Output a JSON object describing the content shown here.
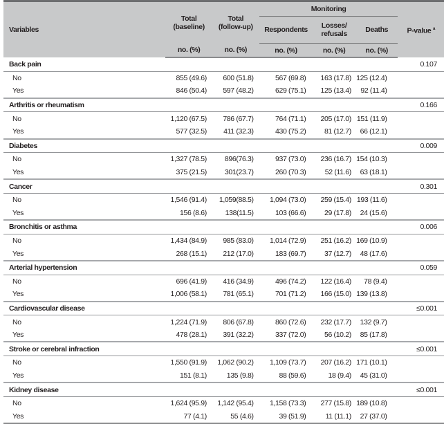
{
  "header": {
    "variables": "Variables",
    "total_baseline_line1": "Total",
    "total_baseline_line2": "(baseline)",
    "total_followup_line1": "Total",
    "total_followup_line2": "(follow-up)",
    "monitoring": "Monitoring",
    "respondents": "Respondents",
    "losses_line1": "Losses/",
    "losses_line2": "refusals",
    "deaths": "Deaths",
    "pvalue": "P-value",
    "pvalue_footnote": "a",
    "unit": "no. (%)"
  },
  "groups": [
    {
      "name": "Back pain",
      "p": "0.107",
      "rows": [
        {
          "label": "No",
          "values": [
            "855 (49.6)",
            "600 (51.8)",
            "567 (69.8)",
            "163 (17.8)",
            "125 (12.4)"
          ]
        },
        {
          "label": "Yes",
          "values": [
            "846 (50.4)",
            "597 (48.2)",
            "629 (75.1)",
            "125 (13.4)",
            "92 (11.4)"
          ]
        }
      ]
    },
    {
      "name": "Arthritis or rheumatism",
      "p": "0.166",
      "rows": [
        {
          "label": "No",
          "values": [
            "1,120 (67.5)",
            "786 (67.7)",
            "764 (71.1)",
            "205 (17.0)",
            "151 (11.9)"
          ]
        },
        {
          "label": "Yes",
          "values": [
            "577 (32.5)",
            "411 (32.3)",
            "430 (75.2)",
            "81 (12.7)",
            "66 (12.1)"
          ]
        }
      ]
    },
    {
      "name": "Diabetes",
      "p": "0.009",
      "rows": [
        {
          "label": "No",
          "values": [
            "1,327 (78.5)",
            "896(76.3)",
            "937 (73.0)",
            "236 (16.7)",
            "154 (10.3)"
          ]
        },
        {
          "label": "Yes",
          "values": [
            "375 (21.5)",
            "301(23.7)",
            "260 (70.3)",
            "52 (11.6)",
            "63 (18.1)"
          ]
        }
      ]
    },
    {
      "name": "Cancer",
      "p": "0.301",
      "rows": [
        {
          "label": "No",
          "values": [
            "1,546 (91.4)",
            "1,059(88.5)",
            "1,094 (73.0)",
            "259 (15.4)",
            "193 (11.6)"
          ]
        },
        {
          "label": "Yes",
          "values": [
            "156 (8.6)",
            "138(11.5)",
            "103 (66.6)",
            "29 (17.8)",
            "24 (15.6)"
          ]
        }
      ]
    },
    {
      "name": "Bronchitis or asthma",
      "p": "0.006",
      "rows": [
        {
          "label": "No",
          "values": [
            "1,434 (84.9)",
            "985 (83.0)",
            "1,014 (72.9)",
            "251 (16.2)",
            "169 (10.9)"
          ]
        },
        {
          "label": "Yes",
          "values": [
            "268 (15.1)",
            "212 (17.0)",
            "183 (69.7)",
            "37 (12.7)",
            "48 (17.6)"
          ]
        }
      ]
    },
    {
      "name": "Arterial hypertension",
      "p": "0.059",
      "rows": [
        {
          "label": "No",
          "values": [
            "696 (41.9)",
            "416 (34.9)",
            "496 (74.2)",
            "122 (16.4)",
            "78 (9.4)"
          ]
        },
        {
          "label": "Yes",
          "values": [
            "1,006 (58.1)",
            "781 (65.1)",
            "701 (71.2)",
            "166 (15.0)",
            "139 (13.8)"
          ]
        }
      ]
    },
    {
      "name": "Cardiovascular disease",
      "p": "≤0.001",
      "rows": [
        {
          "label": "No",
          "values": [
            "1,224 (71.9)",
            "806 (67.8)",
            "860 (72.6)",
            "232 (17.7)",
            "132 (9.7)"
          ]
        },
        {
          "label": "Yes",
          "values": [
            "478 (28.1)",
            "391 (32.2)",
            "337 (72.0)",
            "56 (10.2)",
            "85 (17.8)"
          ]
        }
      ]
    },
    {
      "name": "Stroke or cerebral infraction",
      "p": "≤0.001",
      "rows": [
        {
          "label": "No",
          "values": [
            "1,550 (91.9)",
            "1,062 (90.2)",
            "1,109 (73.7)",
            "207 (16.2)",
            "171 (10.1)"
          ]
        },
        {
          "label": "Yes",
          "values": [
            "151 (8.1)",
            "135 (9.8)",
            "88 (59.6)",
            "18 (9.4)",
            "45 (31.0)"
          ]
        }
      ]
    },
    {
      "name": "Kidney disease",
      "p": "≤0.001",
      "rows": [
        {
          "label": "No",
          "values": [
            "1,624 (95.9)",
            "1,142 (95.4)",
            "1,158 (73.3)",
            "277 (15.8)",
            "189 (10.8)"
          ]
        },
        {
          "label": "Yes",
          "values": [
            "77 (4.1)",
            "55 (4.6)",
            "39 (51.9)",
            "11 (11.1)",
            "27 (37.0)"
          ]
        }
      ]
    }
  ]
}
